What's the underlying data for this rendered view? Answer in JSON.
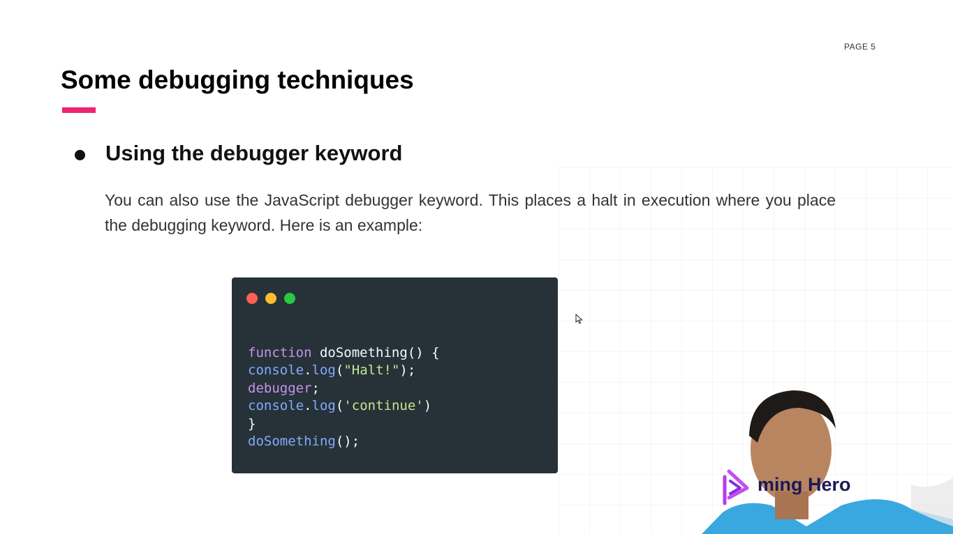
{
  "slide": {
    "page_label": "PAGE 5",
    "title": "Some debugging techniques",
    "bullet_heading": "Using the debugger keyword",
    "paragraph": "You can also use the JavaScript debugger keyword. This places a halt in execution where you place the debugging keyword. Here is an example:"
  },
  "code_window": {
    "lines": [
      [
        {
          "t": "kw",
          "v": "function"
        },
        {
          "t": "pl",
          "v": " doSomething() {"
        }
      ],
      [
        {
          "t": "fn",
          "v": "console"
        },
        {
          "t": "pl",
          "v": "."
        },
        {
          "t": "fn",
          "v": "log"
        },
        {
          "t": "pl",
          "v": "("
        },
        {
          "t": "str",
          "v": "\"Halt!\""
        },
        {
          "t": "pl",
          "v": ");"
        }
      ],
      [
        {
          "t": "kw",
          "v": "debugger"
        },
        {
          "t": "pl",
          "v": ";"
        }
      ],
      [
        {
          "t": "fn",
          "v": "console"
        },
        {
          "t": "pl",
          "v": "."
        },
        {
          "t": "fn",
          "v": "log"
        },
        {
          "t": "pl",
          "v": "("
        },
        {
          "t": "str",
          "v": "'continue'"
        },
        {
          "t": "pl",
          "v": ")"
        }
      ],
      [
        {
          "t": "pl",
          "v": "}"
        }
      ],
      [
        {
          "t": "fn",
          "v": "doSomething"
        },
        {
          "t": "pl",
          "v": "();"
        }
      ]
    ],
    "dot_colors": {
      "red": "#ff5f57",
      "yellow": "#febc2e",
      "green": "#28c840"
    }
  },
  "brand": {
    "text": "Programming Hero",
    "visible_text": "ming Hero",
    "logo_color": "#b23cf0"
  },
  "colors": {
    "accent": "#f0246f",
    "code_bg": "#263238"
  },
  "icons": {
    "cursor": "mouse-pointer-icon",
    "logo": "play-logo-icon"
  }
}
